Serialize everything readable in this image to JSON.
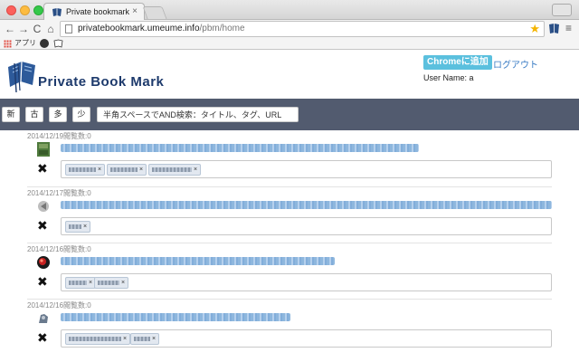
{
  "browser": {
    "tab_title": "Private bookmark",
    "tab_close": "×",
    "url_host": "privatebookmark.umeume.info",
    "url_path": "/pbm/home",
    "nav_back": "←",
    "nav_forward": "→",
    "nav_reload": "C",
    "nav_home": "⌂",
    "star": "★",
    "menu": "≡",
    "apps_label": "アプリ"
  },
  "header": {
    "site_title": "Private Book Mark",
    "chrome_add_label": "Chromeに追加",
    "logout_label": "ログアウト",
    "username_text": "User Name: a"
  },
  "controls": {
    "sort_buttons": [
      "新",
      "古",
      "多",
      "少"
    ],
    "search_placeholder": "半角スペースでAND検索：タイトル、タグ、URL"
  },
  "entries": [
    {
      "date": "2014/12/19閲覧数:0",
      "delete_icon": "✖",
      "tags": [
        {
          "label": "tag",
          "remove": "×"
        },
        {
          "label": "tag",
          "remove": "×"
        },
        {
          "label": "tag",
          "remove": "×"
        }
      ]
    },
    {
      "date": "2014/12/17閲覧数:0",
      "delete_icon": "✖",
      "tags": [
        {
          "label": "tag",
          "remove": "×"
        }
      ]
    },
    {
      "date": "2014/12/16閲覧数:0",
      "delete_icon": "✖",
      "tags": [
        {
          "label": "tag",
          "remove": "×"
        },
        {
          "label": "tag",
          "remove": "×"
        }
      ]
    },
    {
      "date": "2014/12/16閲覧数:0",
      "delete_icon": "✖",
      "tags": [
        {
          "label": "tag",
          "remove": "×"
        },
        {
          "label": "tag",
          "remove": "×"
        }
      ]
    }
  ],
  "colors": {
    "control_bar": "#525b6f",
    "brand": "#1d3a6c",
    "chrome_add": "#5bc0de",
    "link": "#3a7cc4"
  }
}
